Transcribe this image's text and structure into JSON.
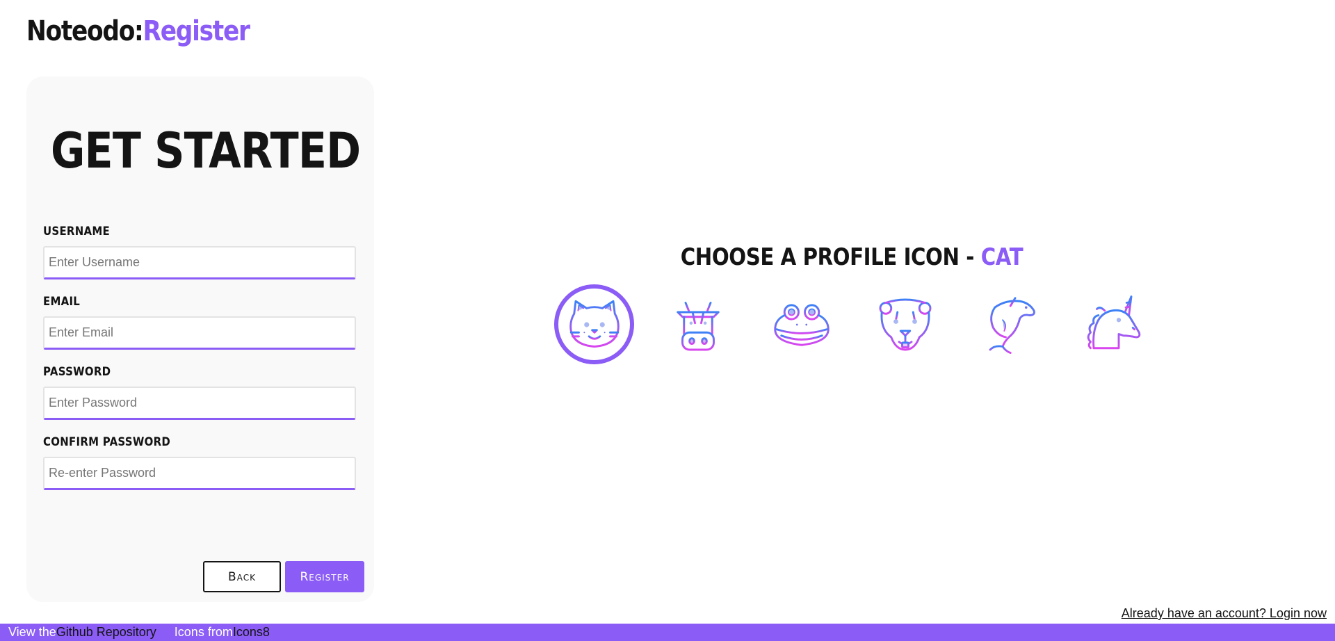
{
  "header": {
    "app_name": "Noteodo:",
    "page_name": "Register"
  },
  "form": {
    "title": "GET STARTED",
    "fields": [
      {
        "label": "USERNAME",
        "placeholder": "Enter Username"
      },
      {
        "label": "EMAIL",
        "placeholder": "Enter Email"
      },
      {
        "label": "PASSWORD",
        "placeholder": "Enter Password"
      },
      {
        "label": "CONFIRM PASSWORD",
        "placeholder": "Re-enter Password"
      }
    ],
    "back_label": "Back",
    "register_label": "Register"
  },
  "profile": {
    "prompt": "CHOOSE A PROFILE ICON - ",
    "selected_name": "CAT",
    "icons": [
      "cat-icon",
      "cow-icon",
      "frog-icon",
      "bear-icon",
      "dolphin-icon",
      "unicorn-icon"
    ],
    "selected_index": 0
  },
  "login_link": "Already have an account? Login now",
  "footer": {
    "view_prefix": "View the ",
    "repo_link": "Github Repository",
    "icons_prefix": "Icons from ",
    "icons_link": "Icons8"
  },
  "colors": {
    "accent": "#8b5cf6",
    "icon_gradient_start": "#3b82f6",
    "icon_gradient_end": "#d946ef",
    "text": "#141414",
    "card": "#f9f9f9"
  }
}
